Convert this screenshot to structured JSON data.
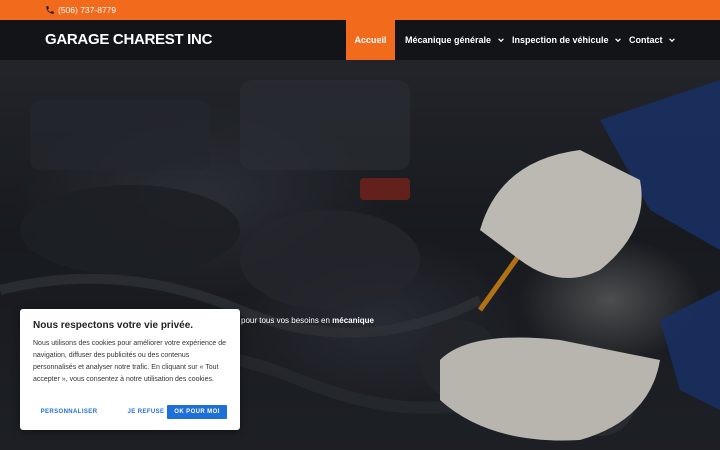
{
  "topbar": {
    "phone": "(506) 737-8779",
    "phone_icon": "phone-icon",
    "color": "#f26a1b"
  },
  "header": {
    "brand": "GARAGE CHAREST INC",
    "nav": [
      {
        "label": "Accueil",
        "active": true
      },
      {
        "label": "Mécanique générale",
        "has_dropdown": true
      },
      {
        "label": "Inspection de véhicule",
        "has_dropdown": true
      },
      {
        "label": "Contact",
        "has_dropdown": true
      }
    ]
  },
  "hero": {
    "text_before": "pour tous vos besoins en ",
    "text_bold": "mécanique"
  },
  "cookie_banner": {
    "title": "Nous respectons votre vie privée.",
    "body": "Nous utilisons des cookies pour améliorer votre expérience de navigation, diffuser des publicités ou des contenus personnalisés et analyser notre trafic. En cliquant sur « Tout accepter », vous consentez à notre utilisation des cookies.",
    "buttons": {
      "customize": "PERSONNALISER",
      "refuse": "JE REFUSE",
      "accept": "OK POUR MOI"
    },
    "accent_color": "#1e6fd9"
  }
}
